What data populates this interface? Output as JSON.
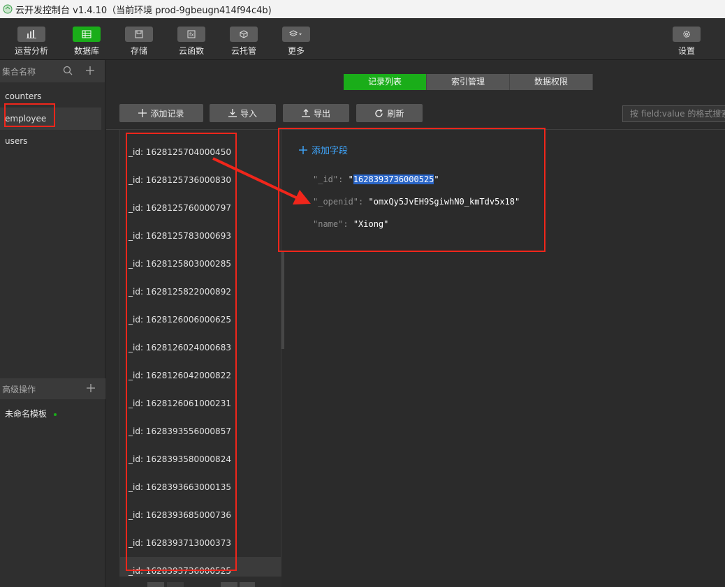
{
  "window": {
    "title": "云开发控制台 v1.4.10（当前环境 prod-9gbeugn414f94c4b)"
  },
  "toolbar": {
    "items": [
      {
        "label": "运营分析",
        "icon": "bar-chart-icon"
      },
      {
        "label": "数据库",
        "icon": "database-icon"
      },
      {
        "label": "存储",
        "icon": "storage-icon"
      },
      {
        "label": "云函数",
        "icon": "function-icon"
      },
      {
        "label": "云托管",
        "icon": "cube-icon"
      },
      {
        "label": "更多",
        "icon": "layers-icon"
      }
    ],
    "settings_label": "设置"
  },
  "sidebar": {
    "header": "集合名称",
    "collections": [
      "counters",
      "employee",
      "users"
    ],
    "advanced_header": "高级操作",
    "template_label": "未命名模板"
  },
  "tabs": [
    "记录列表",
    "索引管理",
    "数据权限"
  ],
  "actions": {
    "add": "添加记录",
    "import": "导入",
    "export": "导出",
    "refresh": "刷新"
  },
  "search": {
    "placeholder": "按 field:value 的格式搜索"
  },
  "records": [
    "_id: 1628125704000450",
    "_id: 1628125736000830",
    "_id: 1628125760000797",
    "_id: 1628125783000693",
    "_id: 1628125803000285",
    "_id: 1628125822000892",
    "_id: 1628126006000625",
    "_id: 1628126024000683",
    "_id: 1628126042000822",
    "_id: 1628126061000231",
    "_id: 1628393556000857",
    "_id: 1628393580000824",
    "_id: 1628393663000135",
    "_id: 1628393685000736",
    "_id: 1628393713000373",
    "_id: 1628393736000525"
  ],
  "detail": {
    "add_field": "添加字段",
    "fields": [
      {
        "key": "\"_id\"",
        "value": "1628393736000525"
      },
      {
        "key": "\"_openid\"",
        "value": "\"omxQy5JvEH9SgiwhN0_kmTdv5x18\""
      },
      {
        "key": "\"name\"",
        "value": "\"Xiong\""
      }
    ]
  },
  "colors": {
    "accent": "#1aad19",
    "annotation": "#f0261b",
    "link": "#3fa7ff"
  }
}
